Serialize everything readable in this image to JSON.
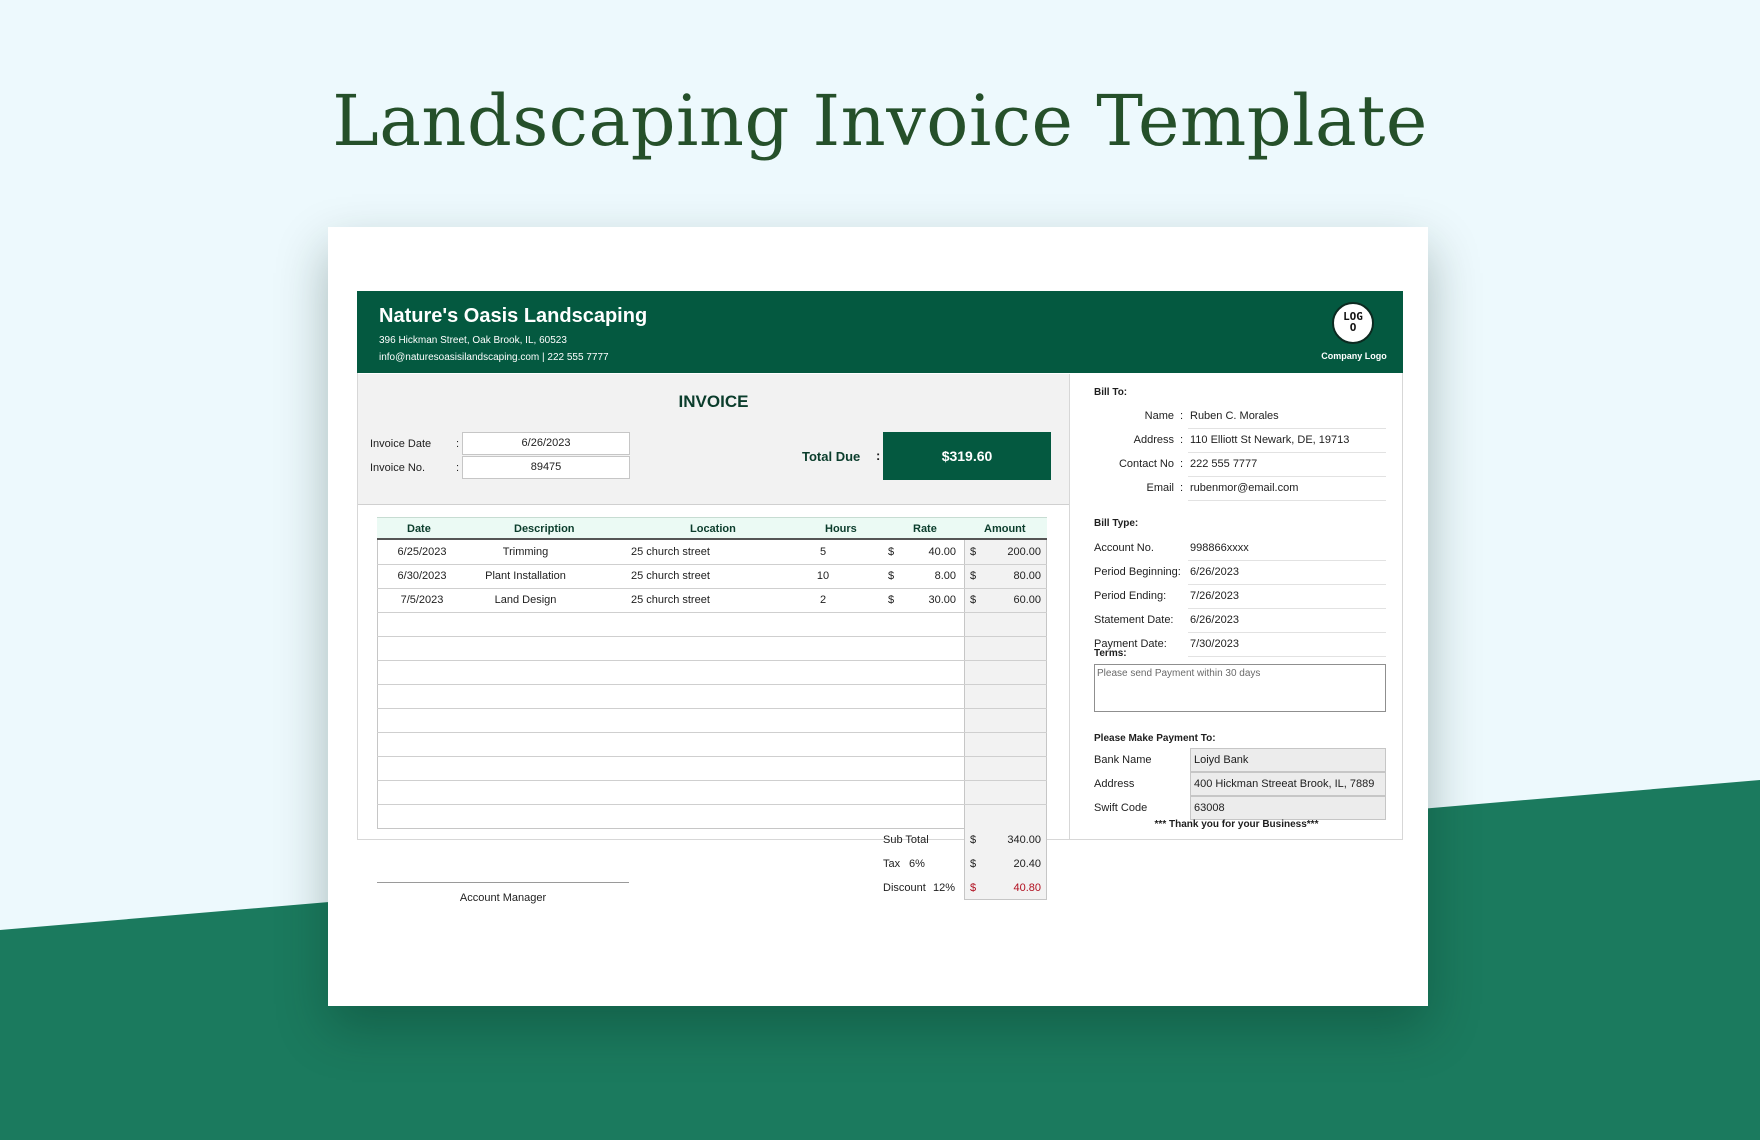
{
  "page_title": "Landscaping Invoice Template",
  "colors": {
    "background": "#edf9fd",
    "band": "#1b7a5e",
    "header": "#045940",
    "title": "#25502a",
    "discount": "#b10f1f"
  },
  "company": {
    "name": "Nature's Oasis Landscaping",
    "address": "396 Hickman Street, Oak Brook, IL, 60523",
    "contact": "info@naturesoasisilandscaping.com | 222 555 7777",
    "logo_text": "LOGO",
    "logo_caption": "Company Logo"
  },
  "invoice": {
    "heading": "INVOICE",
    "date_label": "Invoice Date",
    "date_value": "6/26/2023",
    "number_label": "Invoice No.",
    "number_value": "89475",
    "colon": ":",
    "total_label": "Total Due",
    "total_value": "$319.60"
  },
  "table": {
    "headers": [
      "Date",
      "Description",
      "Location",
      "Hours",
      "Rate",
      "Amount"
    ],
    "currency": "$",
    "rows": [
      {
        "date": "6/25/2023",
        "description": "Trimming",
        "location": "25 church street",
        "hours": "5",
        "rate": "40.00",
        "amount": "200.00"
      },
      {
        "date": "6/30/2023",
        "description": "Plant Installation",
        "location": "25 church street",
        "hours": "10",
        "rate": "8.00",
        "amount": "80.00"
      },
      {
        "date": "7/5/2023",
        "description": "Land Design",
        "location": "25 church street",
        "hours": "2",
        "rate": "30.00",
        "amount": "60.00"
      }
    ]
  },
  "summary": {
    "subtotal_label": "Sub Total",
    "subtotal_value": "340.00",
    "tax_label": "Tax",
    "tax_rate": "6%",
    "tax_value": "20.40",
    "discount_label": "Discount",
    "discount_rate": "12%",
    "discount_value": "40.80"
  },
  "signature_label": "Account Manager",
  "bill_to": {
    "heading": "Bill To:",
    "fields": [
      {
        "label": "Name",
        "value": "Ruben C. Morales"
      },
      {
        "label": "Address",
        "value": "110 Elliott St Newark, DE, 19713"
      },
      {
        "label": "Contact No",
        "value": "222 555 7777"
      },
      {
        "label": "Email",
        "value": "rubenmor@email.com"
      }
    ]
  },
  "bill_type": {
    "heading": "Bill Type:",
    "fields": [
      {
        "label": "Account No.",
        "value": "998866xxxx"
      },
      {
        "label": "Period Beginning:",
        "value": "6/26/2023"
      },
      {
        "label": "Period Ending:",
        "value": "7/26/2023"
      },
      {
        "label": "Statement Date:",
        "value": "6/26/2023"
      },
      {
        "label": "Payment Date:",
        "value": "7/30/2023"
      }
    ]
  },
  "terms": {
    "heading": "Terms:",
    "text": "Please send Payment within 30 days"
  },
  "payment": {
    "heading": "Please Make Payment To:",
    "fields": [
      {
        "label": "Bank Name",
        "value": "Loiyd Bank"
      },
      {
        "label": "Address",
        "value": "400 Hickman Streeat Brook, IL, 7889"
      },
      {
        "label": "Swift Code",
        "value": "63008"
      }
    ]
  },
  "thanks": "*** Thank you for your Business***"
}
